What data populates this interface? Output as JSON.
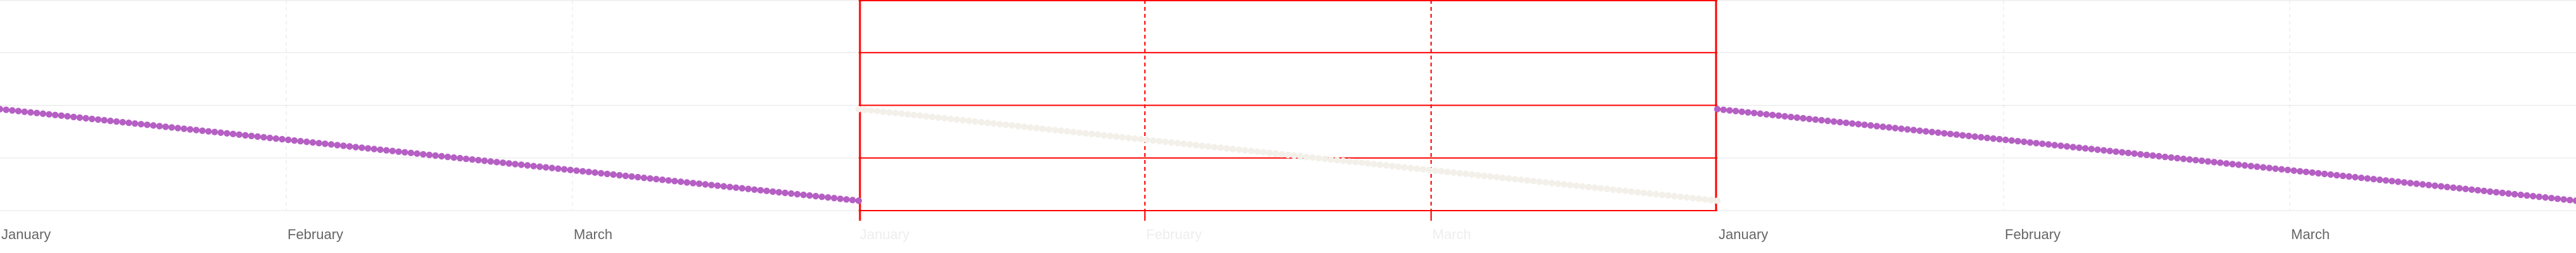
{
  "chart_data": [
    {
      "type": "scatter",
      "panel": "left",
      "categories": [
        "January",
        "February",
        "March"
      ],
      "series": [
        {
          "values": [
            2.0,
            1.5,
            1.0,
            0.5
          ]
        }
      ],
      "ylim": [
        0,
        4
      ],
      "grid": true,
      "point_color": "#b55fc4",
      "axis_color": "#e6e6e6",
      "tick_color": "#666666"
    },
    {
      "type": "scatter",
      "panel": "middle",
      "categories": [
        "January",
        "February",
        "March"
      ],
      "series": [
        {
          "values": [
            2.0,
            1.5,
            1.0,
            0.5
          ]
        }
      ],
      "ylim": [
        0,
        4
      ],
      "grid": true,
      "point_color": "#f3f0ea",
      "axis_color": "#ff0000",
      "tick_color": "#eeeeee"
    },
    {
      "type": "scatter",
      "panel": "right",
      "categories": [
        "January",
        "February",
        "March"
      ],
      "series": [
        {
          "values": [
            2.0,
            1.5,
            1.0,
            0.5
          ]
        }
      ],
      "ylim": [
        0,
        4
      ],
      "grid": true,
      "point_color": "#b55fc4",
      "axis_color": "#e6e6e6",
      "tick_color": "#666666"
    }
  ]
}
